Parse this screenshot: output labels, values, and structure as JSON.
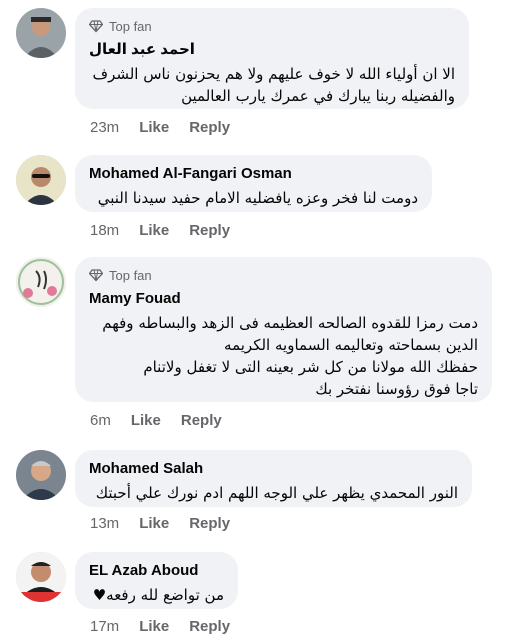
{
  "comments": [
    {
      "top_fan": "Top fan",
      "name": "احمد عبد العال",
      "text": "الا ان أولياء الله لا خوف عليهم ولا هم يحزنون ناس الشرف والفضيله ربنا يبارك في عمرك يارب العالمين",
      "time": "23m",
      "like": "Like",
      "reply": "Reply"
    },
    {
      "name": "Mohamed Al-Fangari Osman",
      "text": "دومت لنا فخر وعزه يافضليه الامام حفيد سيدنا النبي",
      "time": "18m",
      "like": "Like",
      "reply": "Reply"
    },
    {
      "top_fan": "Top fan",
      "name": "Mamy Fouad",
      "text_lines": [
        "دمت رمزا للقدوه الصالحه العظيمه فى الزهد والبساطه  وفهم",
        "الدين بسماحته وتعاليمه السماويه الكريمه",
        "حفظك الله مولانا من كل شر بعينه التى لا تغفل ولاتنام",
        "تاجا فوق رؤوسنا نفتخر بك"
      ],
      "time": "6m",
      "like": "Like",
      "reply": "Reply"
    },
    {
      "name": "Mohamed Salah",
      "text": "النور المحمدي يظهر علي الوجه اللهم ادم نورك علي أحبتك",
      "time": "13m",
      "like": "Like",
      "reply": "Reply"
    },
    {
      "name": "EL Azab Aboud",
      "text": "من تواضع لله رفعه",
      "heart": "♥",
      "time": "17m",
      "like": "Like",
      "reply": "Reply"
    }
  ],
  "icons": {
    "top_fan_badge": "diamond-icon",
    "heart": "heart-icon"
  },
  "colors": {
    "bubble": "#f0f2f5",
    "meta": "#65676b",
    "text": "#050505"
  }
}
